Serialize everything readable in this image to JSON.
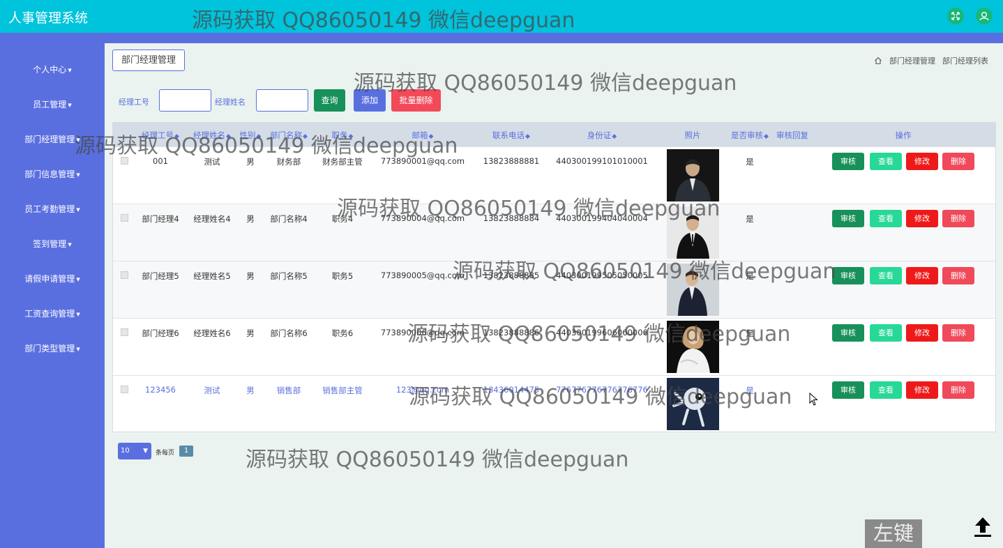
{
  "header": {
    "title": "人事管理系统",
    "fullscreen_icon": "expand-icon",
    "user_icon": "user-icon"
  },
  "sidebar": {
    "items": [
      {
        "label": "个人中心"
      },
      {
        "label": "员工管理"
      },
      {
        "label": "部门经理管理"
      },
      {
        "label": "部门信息管理"
      },
      {
        "label": "员工考勤管理"
      },
      {
        "label": "签到管理"
      },
      {
        "label": "请假申请管理"
      },
      {
        "label": "工资查询管理"
      },
      {
        "label": "部门类型管理"
      }
    ]
  },
  "page": {
    "title_button": "部门经理管理",
    "breadcrumb": [
      "部门经理管理",
      "部门经理列表"
    ]
  },
  "search": {
    "label_id": "经理工号",
    "label_name": "经理姓名",
    "query": "查询",
    "add": "添加",
    "batch_delete": "批量删除"
  },
  "table": {
    "headers": [
      "经理工号",
      "经理姓名",
      "性别",
      "部门名称",
      "职务",
      "邮箱",
      "联系电话",
      "身份证",
      "照片",
      "是否审核",
      "审核回复",
      "操作"
    ],
    "rows": [
      {
        "id": "001",
        "name": "测试",
        "gender": "男",
        "dept": "财务部",
        "role": "财务部主管",
        "email": "773890001@qq.com",
        "phone": "13823888881",
        "idcard": "440300199101010001",
        "audited": "是"
      },
      {
        "id": "部门经理4",
        "name": "经理姓名4",
        "gender": "男",
        "dept": "部门名称4",
        "role": "职务4",
        "email": "773890004@qq.com",
        "phone": "13823888884",
        "idcard": "440300199404040004",
        "audited": "是"
      },
      {
        "id": "部门经理5",
        "name": "经理姓名5",
        "gender": "男",
        "dept": "部门名称5",
        "role": "职务5",
        "email": "773890005@qq.com",
        "phone": "13823888885",
        "idcard": "440300199505050005",
        "audited": "是"
      },
      {
        "id": "部门经理6",
        "name": "经理姓名6",
        "gender": "男",
        "dept": "部门名称6",
        "role": "职务6",
        "email": "773890006@qq.com",
        "phone": "13823888886",
        "idcard": "440300199606060006",
        "audited": "是"
      },
      {
        "id": "123456",
        "name": "测试",
        "gender": "男",
        "dept": "销售部",
        "role": "销售部主管",
        "email": "123@qq.com",
        "phone": "13436014475",
        "idcard": "776776776776776776",
        "audited": "是"
      }
    ],
    "actions": {
      "audit": "审核",
      "view": "查看",
      "edit": "修改",
      "delete": "删除"
    }
  },
  "pager": {
    "page_size": "10",
    "per_page_label": "条每页",
    "current_page": "1"
  },
  "watermark": "源码获取 QQ86050149 微信deepguan",
  "overlay": {
    "left_key": "左键"
  },
  "colors": {
    "topbar": "#00c3dc",
    "sidebar": "#5a6fdf",
    "accent": "#5a6fdf"
  }
}
